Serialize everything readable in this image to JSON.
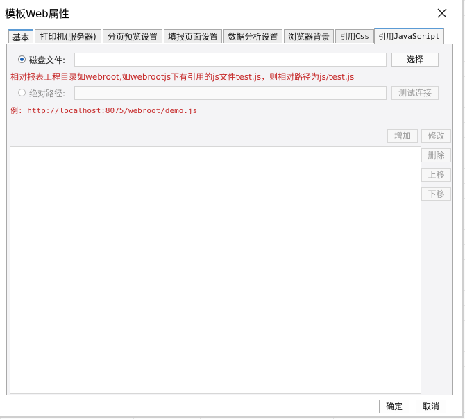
{
  "window": {
    "title": "模板Web属性",
    "close_icon": "close-icon"
  },
  "tabs": [
    {
      "label": "基本",
      "active": false
    },
    {
      "label": "打印机(服务器)",
      "active": false
    },
    {
      "label": "分页预览设置",
      "active": false
    },
    {
      "label": "填报页面设置",
      "active": false
    },
    {
      "label": "数据分析设置",
      "active": false
    },
    {
      "label": "浏览器背景",
      "active": false
    },
    {
      "label": "引用Css",
      "active": false
    },
    {
      "label": "引用JavaScript",
      "active": true
    }
  ],
  "disk_file": {
    "label": "磁盘文件:",
    "value": "",
    "selected": true,
    "choose_button": "选择",
    "hint": "相对报表工程目录如webroot,如webrootjs下有引用的js文件test.js，则相对路径为js/test.js"
  },
  "absolute_path": {
    "label": "绝对路径:",
    "value": "",
    "selected": false,
    "test_button": "测试连接",
    "example": "例: http://localhost:8075/webroot/demo.js"
  },
  "list_actions": {
    "add": "增加",
    "edit": "修改",
    "delete": "删除",
    "move_up": "上移",
    "move_down": "下移"
  },
  "footer": {
    "ok": "确定",
    "cancel": "取消"
  }
}
